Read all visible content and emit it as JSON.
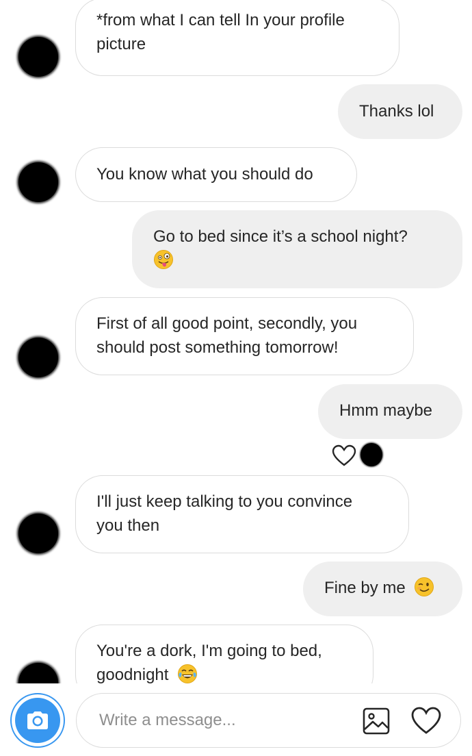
{
  "messages": [
    {
      "direction": "in",
      "lines": [
        "*from what I can tell In your profile",
        "picture"
      ]
    },
    {
      "direction": "out",
      "lines": [
        "Thanks lol"
      ]
    },
    {
      "direction": "in",
      "lines": [
        "You know what you should do"
      ]
    },
    {
      "direction": "out",
      "lines": [
        "Go to bed since it’s a school night?"
      ],
      "emoji": "zany-face-emoji"
    },
    {
      "direction": "in",
      "lines": [
        "First of all good point, secondly, you",
        "should post something tomorrow!"
      ]
    },
    {
      "direction": "out",
      "lines": [
        "Hmm maybe"
      ],
      "reaction": "heart-icon"
    },
    {
      "direction": "in",
      "lines": [
        "I'll just keep talking to you convince",
        "you then"
      ]
    },
    {
      "direction": "out",
      "lines": [
        "Fine by me"
      ],
      "emoji": "winking-face-emoji"
    },
    {
      "direction": "in",
      "lines": [
        "You're a dork, I'm going to bed,",
        "goodnight"
      ],
      "emoji": "tears-of-joy-emoji"
    }
  ],
  "composer": {
    "placeholder": "Write a message...",
    "camera_icon": "camera-icon",
    "gallery_icon": "image-icon",
    "like_icon": "heart-icon"
  },
  "colors": {
    "accent": "#3897f0",
    "outgoing_bubble": "#efefef",
    "incoming_border": "#dbdbdb",
    "text": "#262626",
    "placeholder": "#8e8e8e"
  }
}
